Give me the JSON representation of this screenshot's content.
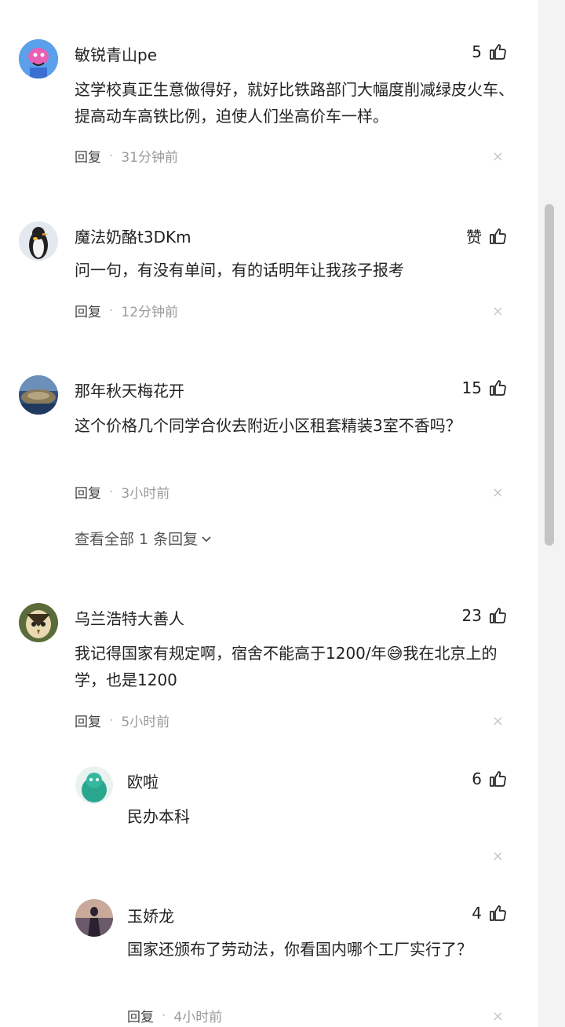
{
  "comments": [
    {
      "name": "敏锐青山pe",
      "likes": "5",
      "text": "这学校真正生意做得好，就好比铁路部门大幅度削减绿皮火车、提高动车高铁比例，迫使人们坐高价车一样。",
      "reply": "回复",
      "time": "31分钟前"
    },
    {
      "name": "魔法奶酪t3DKm",
      "likes": "赞",
      "text": "问一句，有没有单间，有的话明年让我孩子报考",
      "reply": "回复",
      "time": "12分钟前"
    },
    {
      "name": "那年秋天梅花开",
      "likes": "15",
      "text": "这个价格几个同学合伙去附近小区租套精装3室不香吗？",
      "reply": "回复",
      "time": "3小时前",
      "view_replies": "查看全部 1 条回复"
    },
    {
      "name": "乌兰浩特大善人",
      "likes": "23",
      "text_a": "我记得国家有规定啊，宿舍不能高于1200/年",
      "text_b": "我在北京上的学，也是1200",
      "emoji": "😅",
      "reply": "回复",
      "time": "5小时前"
    }
  ],
  "replies": [
    {
      "name": "欧啦",
      "likes": "6",
      "text": "民办本科"
    },
    {
      "name": "玉娇龙",
      "likes": "4",
      "text": "国家还颁布了劳动法，你看国内哪个工厂实行了？",
      "reply": "回复",
      "time": "4小时前"
    }
  ],
  "icons": {
    "like": "thumbs-up-icon",
    "close": "close-icon",
    "chevron": "chevron-down-icon"
  },
  "glyphs": {
    "close": "×",
    "dot": "·"
  }
}
